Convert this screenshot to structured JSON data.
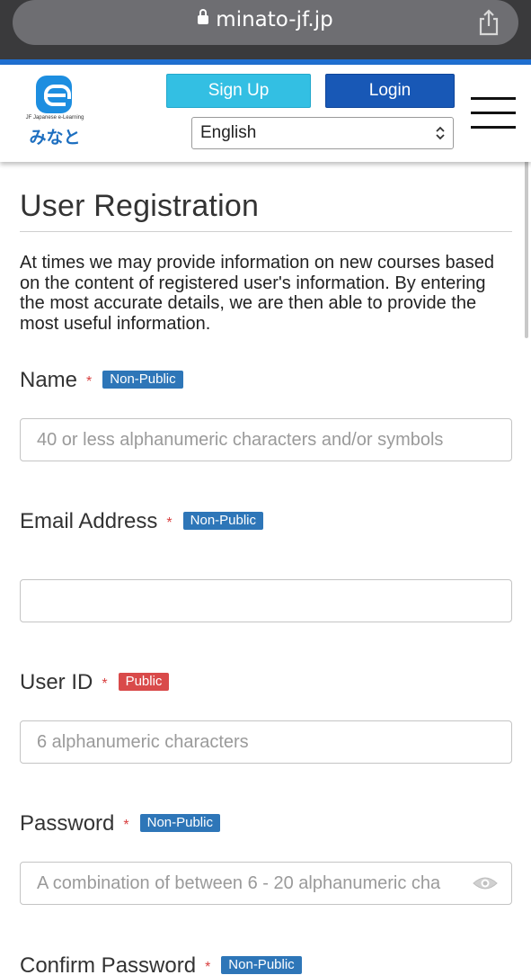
{
  "browser": {
    "url": "minato-jf.jp",
    "lock_icon": "lock-icon",
    "share_icon": "share-icon"
  },
  "header": {
    "logo_sub": "JF Japanese e-Learning",
    "logo_jp": "みなと",
    "signup_label": "Sign Up",
    "login_label": "Login",
    "language_selected": "English",
    "menu_icon": "hamburger-menu-icon",
    "colors": {
      "signup": "#33bfe3",
      "login": "#1858b6",
      "accent_line": "#1f6fd0"
    }
  },
  "main": {
    "title": "User Registration",
    "intro": "At times we may provide information on new courses based on the content of registered user's information. By entering the most accurate details, we are then able to provide the most useful information.",
    "required_mark": "*",
    "fields": [
      {
        "label": "Name",
        "badge": "Non-Public",
        "placeholder": "40 or less alphanumeric characters and/or symbols",
        "value": ""
      },
      {
        "label": "Email Address",
        "badge": "Non-Public",
        "placeholder": "",
        "value": ""
      },
      {
        "label": "User ID",
        "badge": "Public",
        "placeholder": "6 alphanumeric characters",
        "value": ""
      },
      {
        "label": "Password",
        "badge": "Non-Public",
        "placeholder": "A combination of between 6 - 20 alphanumeric cha",
        "value": ""
      },
      {
        "label": "Confirm Password",
        "badge": "Non-Public"
      }
    ],
    "badge_colors": {
      "non_public": "#2e76b8",
      "public": "#d94a4a"
    }
  }
}
